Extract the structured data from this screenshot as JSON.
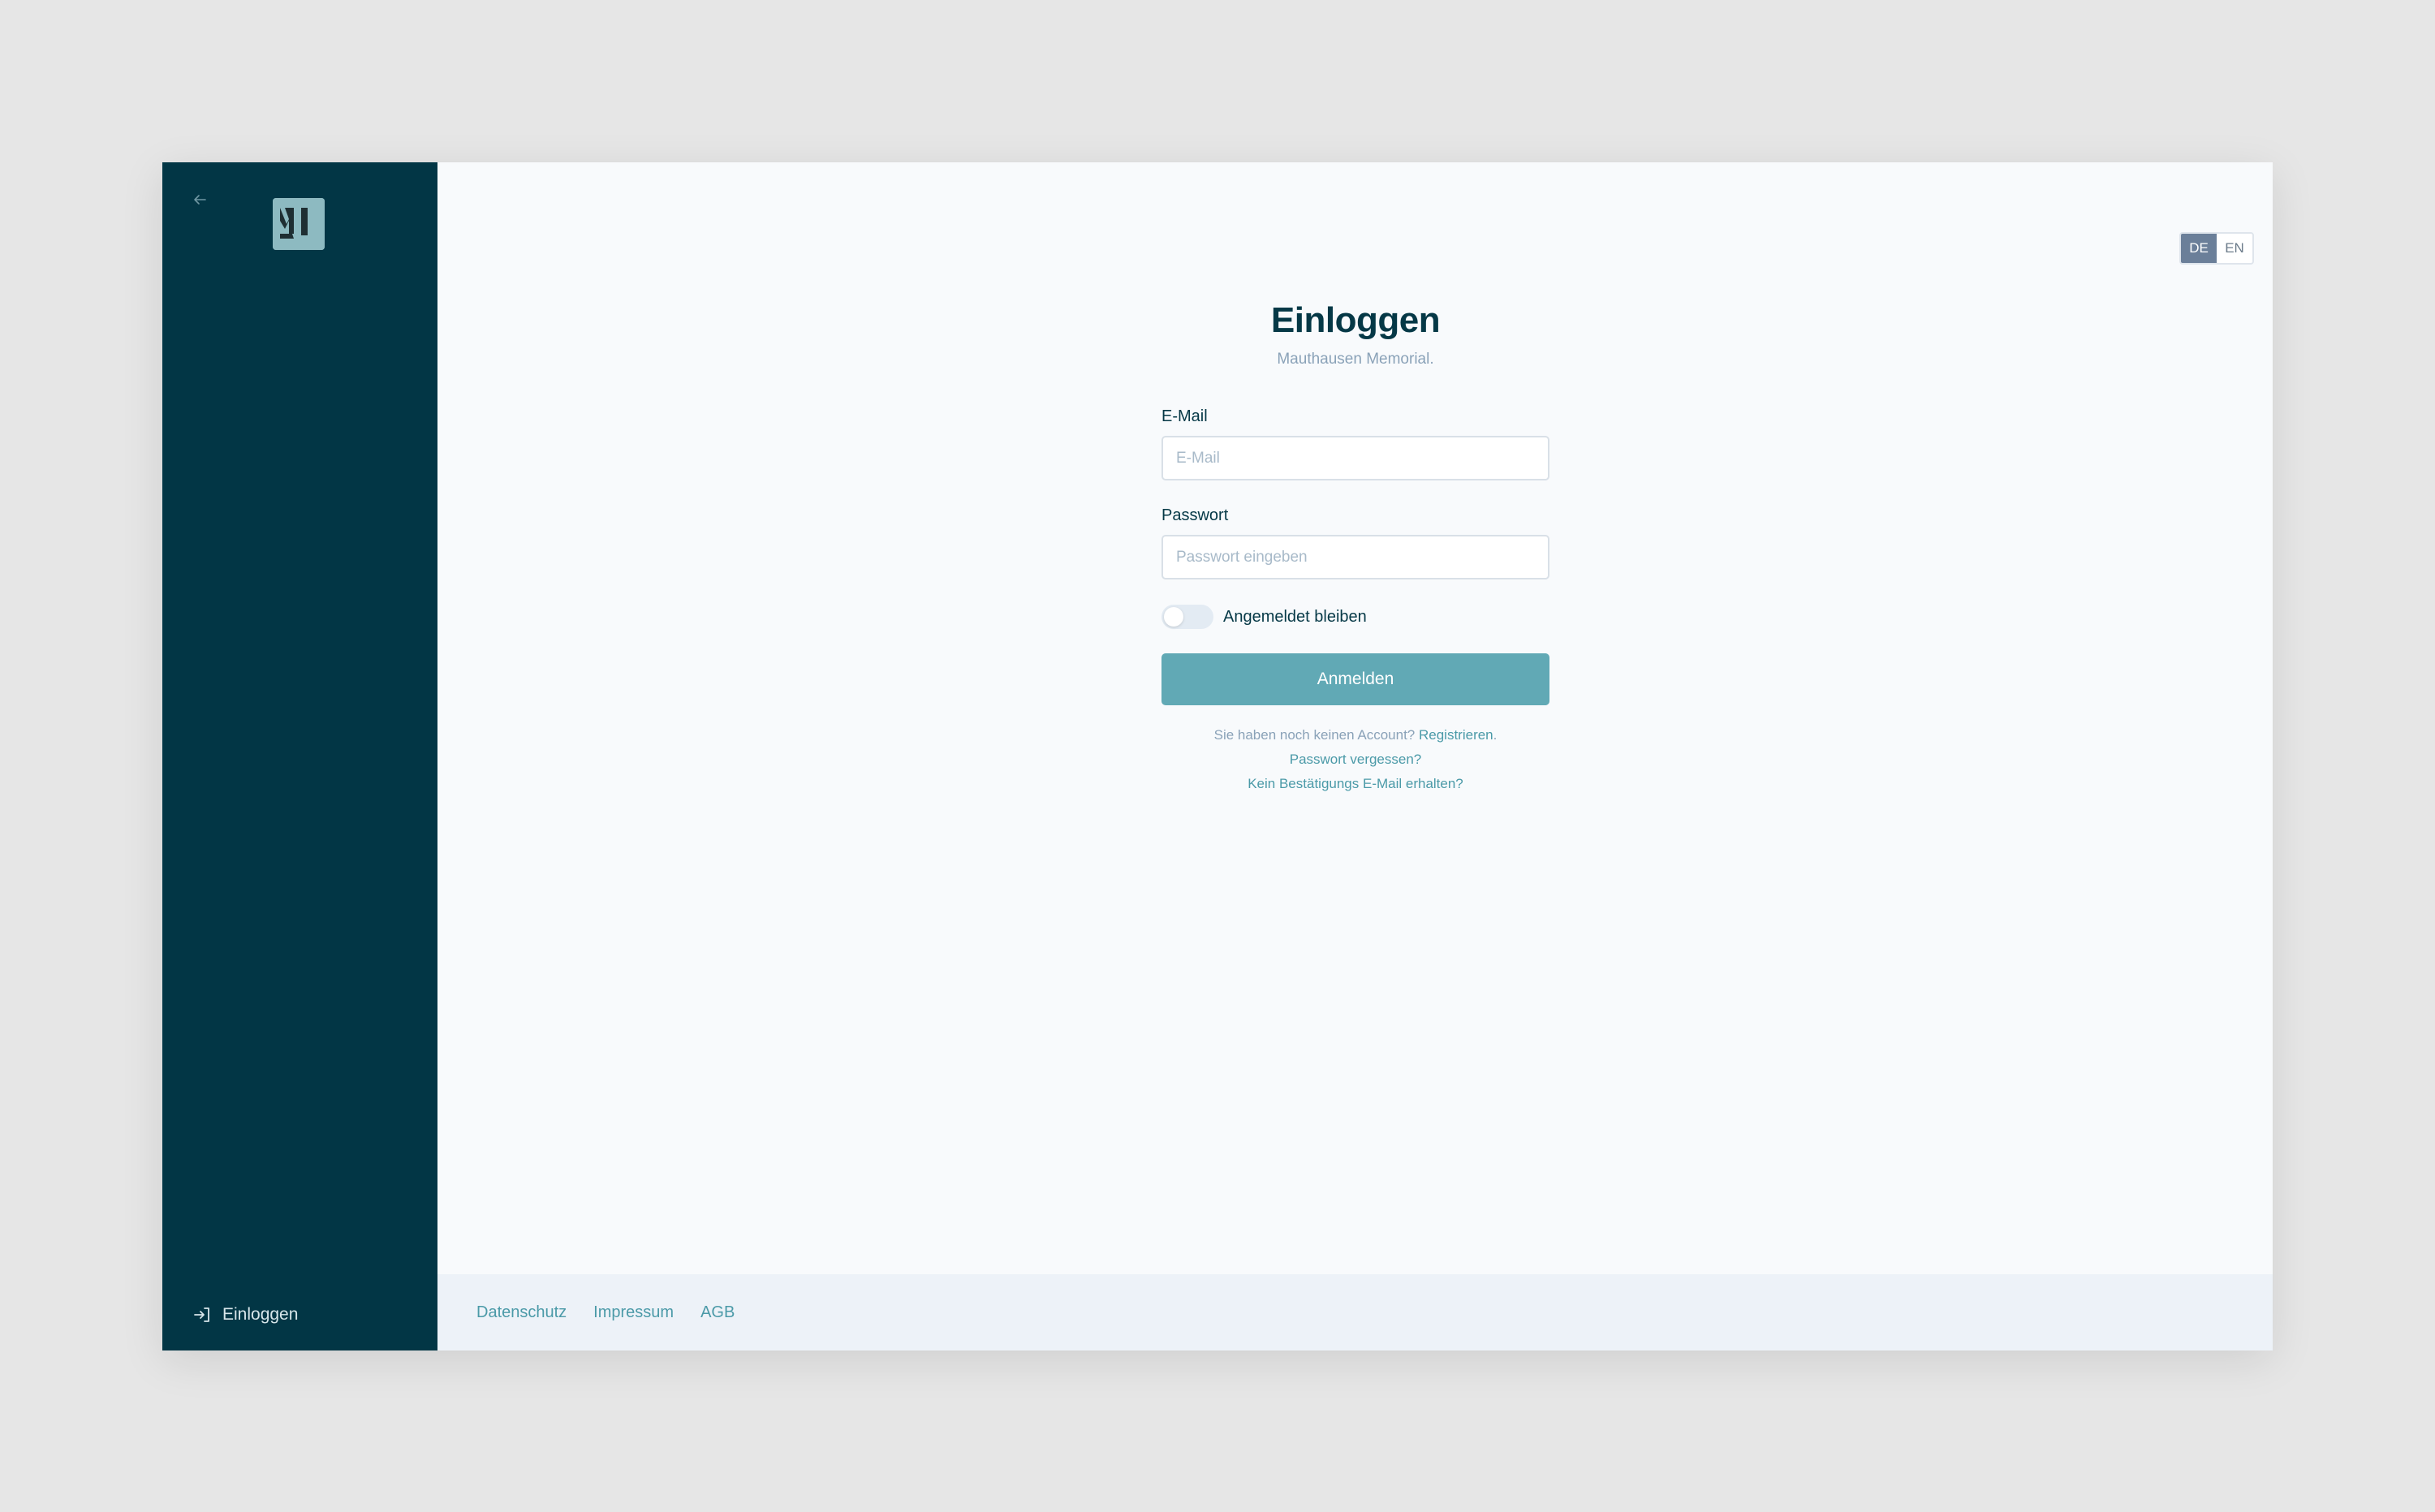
{
  "sidebar": {
    "back_icon": "arrow-left-icon",
    "logo_icon": "mi-logo-icon",
    "login_icon": "sign-in-icon",
    "login_label": "Einloggen"
  },
  "lang": {
    "options": [
      "DE",
      "EN"
    ],
    "selected": "DE"
  },
  "form": {
    "title": "Einloggen",
    "subtitle": "Mauthausen Memorial.",
    "email_label": "E-Mail",
    "email_placeholder": "E-Mail",
    "email_value": "",
    "password_label": "Passwort",
    "password_placeholder": "Passwort eingeben",
    "password_value": "",
    "remember_label": "Angemeldet bleiben",
    "remember_checked": false,
    "submit_label": "Anmelden",
    "no_account_text": "Sie haben noch keinen Account?",
    "register_link": "Registrieren",
    "register_suffix": ".",
    "forgot_link": "Passwort vergessen?",
    "no_confirmation_link": "Kein Bestätigungs E-Mail erhalten?"
  },
  "footer": {
    "links": [
      "Datenschutz",
      "Impressum",
      "AGB"
    ]
  },
  "colors": {
    "sidebar_bg": "#023645",
    "accent": "#61a9b5",
    "title": "#053846",
    "lang_active": "#6b7f99"
  }
}
